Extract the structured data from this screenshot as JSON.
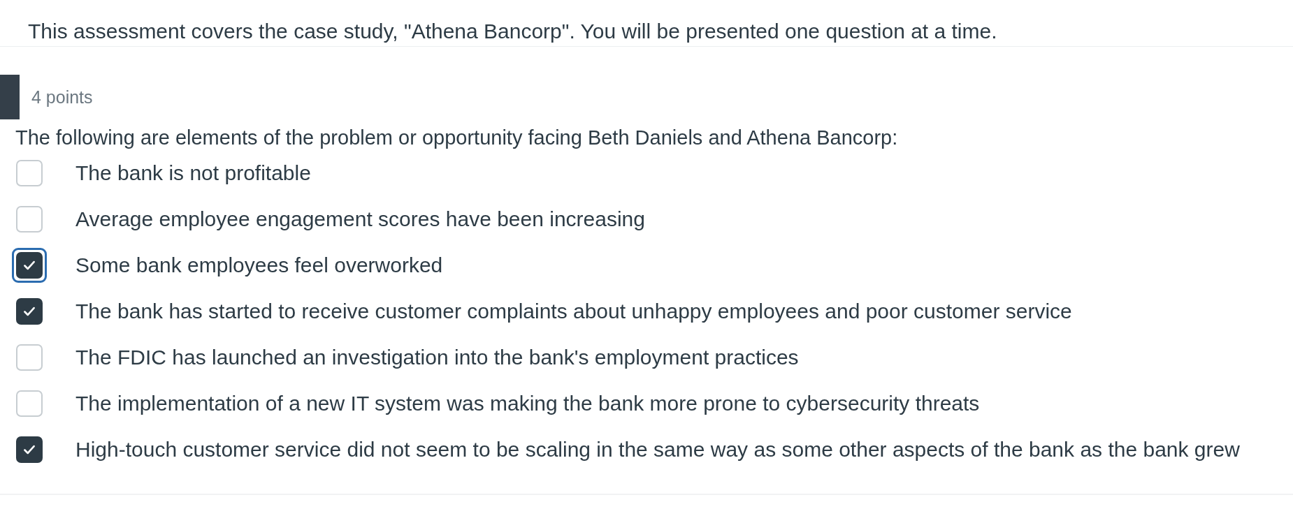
{
  "intro": "This assessment covers the case study, \"Athena Bancorp\". You will be presented one question at a time.",
  "question": {
    "points": "4 points",
    "prompt": "The following are elements of the problem or opportunity facing Beth Daniels and Athena Bancorp:",
    "options": [
      {
        "label": "The bank is not profitable",
        "checked": false,
        "focused": false
      },
      {
        "label": "Average employee engagement scores have been increasing",
        "checked": false,
        "focused": false
      },
      {
        "label": "Some bank employees feel overworked",
        "checked": true,
        "focused": true
      },
      {
        "label": "The bank has started to receive customer complaints about unhappy employees and poor customer service",
        "checked": true,
        "focused": false
      },
      {
        "label": "The FDIC has launched an investigation into the bank's employment practices",
        "checked": false,
        "focused": false
      },
      {
        "label": "The implementation of a new IT system was making the bank more prone to cybersecurity threats",
        "checked": false,
        "focused": false
      },
      {
        "label": "High-touch customer service did not seem to be scaling in the same way as some other aspects of the bank as the bank grew",
        "checked": true,
        "focused": false
      }
    ]
  }
}
